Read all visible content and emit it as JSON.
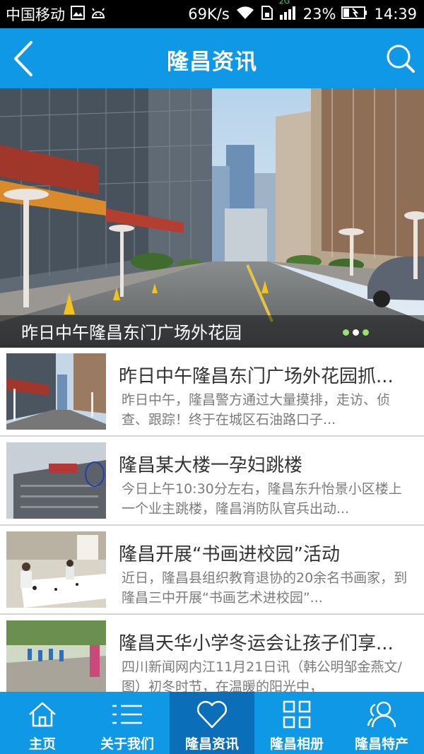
{
  "status_bar": {
    "carrier": "中国移动",
    "net_speed": "69K/s",
    "network_type": "2G",
    "battery": "23%",
    "time": "14:39"
  },
  "header": {
    "title": "隆昌资讯",
    "back_icon": "back-arrow-icon",
    "search_icon": "search-icon",
    "bg_color": "#0e98e5"
  },
  "banner": {
    "caption": "昨日中午隆昌东门广场外花园",
    "slide_count": 3,
    "active_slide": 1
  },
  "news": [
    {
      "title": "昨日中午隆昌东门广场外花园抓...",
      "desc": "昨日中午，隆昌警方通过大量摸排，走访、侦查、跟踪！终于在城区石油路口子..."
    },
    {
      "title": "隆昌某大楼一孕妇跳楼",
      "desc": "今日上午10:30分左右，隆昌东升怡景小区楼上一个业主跳楼，隆昌消防队官兵出动..."
    },
    {
      "title": "隆昌开展“书画进校园”活动",
      "desc": "近日，隆昌县组织教育退协的20余名书画家，到隆昌三中开展“书画艺术进校园”..."
    },
    {
      "title": "隆昌天华小学冬运会让孩子们享...",
      "desc": "四川新闻网内江11月21日讯（韩公明邹金燕文/图）初冬时节，在温暖的阳光中，"
    }
  ],
  "tabs": [
    {
      "label": "主页",
      "icon": "home-icon",
      "active": false
    },
    {
      "label": "关于我们",
      "icon": "list-icon",
      "active": false
    },
    {
      "label": "隆昌资讯",
      "icon": "heart-icon",
      "active": true
    },
    {
      "label": "隆昌相册",
      "icon": "grid-icon",
      "active": false
    },
    {
      "label": "隆昌特产",
      "icon": "users-icon",
      "active": false
    }
  ]
}
